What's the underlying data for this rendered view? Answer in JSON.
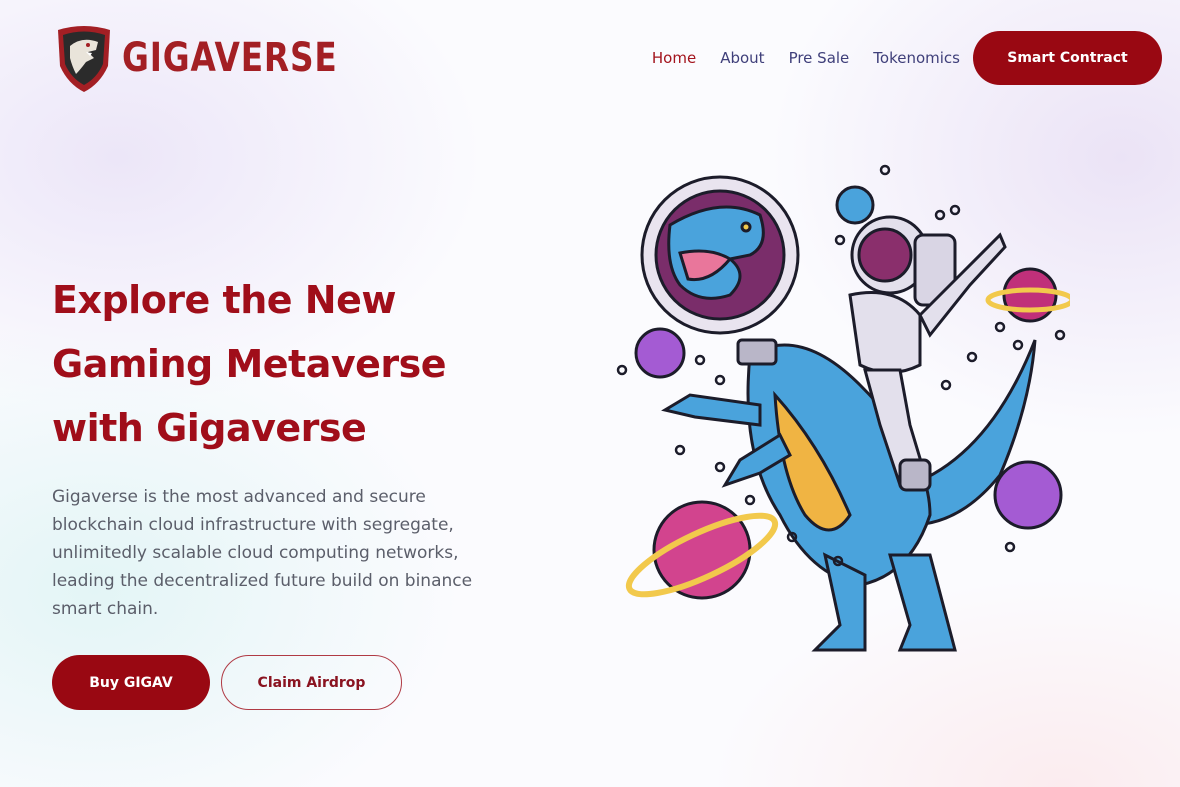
{
  "brand": {
    "name": "GIGAVERSE",
    "logo_icon": "dinosaur-shield-logo",
    "color": "#a31f24"
  },
  "nav": {
    "items": [
      {
        "label": "Home",
        "active": true
      },
      {
        "label": "About",
        "active": false
      },
      {
        "label": "Pre Sale",
        "active": false
      },
      {
        "label": "Tokenomics",
        "active": false
      }
    ],
    "cta_label": "Smart Contract"
  },
  "hero": {
    "title_lines": [
      "Explore the New",
      "Gaming Metaverse",
      "with Gigaverse"
    ],
    "description": "Gigaverse is the most advanced and secure blockchain cloud infrastructure with segregate, unlimitedly scalable cloud computing networks, leading the decentralized future build on binance smart chain.",
    "primary_button": "Buy GIGAV",
    "secondary_button": "Claim Airdrop",
    "illustration": "astronaut-riding-dinosaur-illustration"
  },
  "colors": {
    "primary": "#990812",
    "nav_text": "#3f3f7a",
    "accent_blue": "#4aa3dc",
    "accent_pink": "#c0307a"
  }
}
